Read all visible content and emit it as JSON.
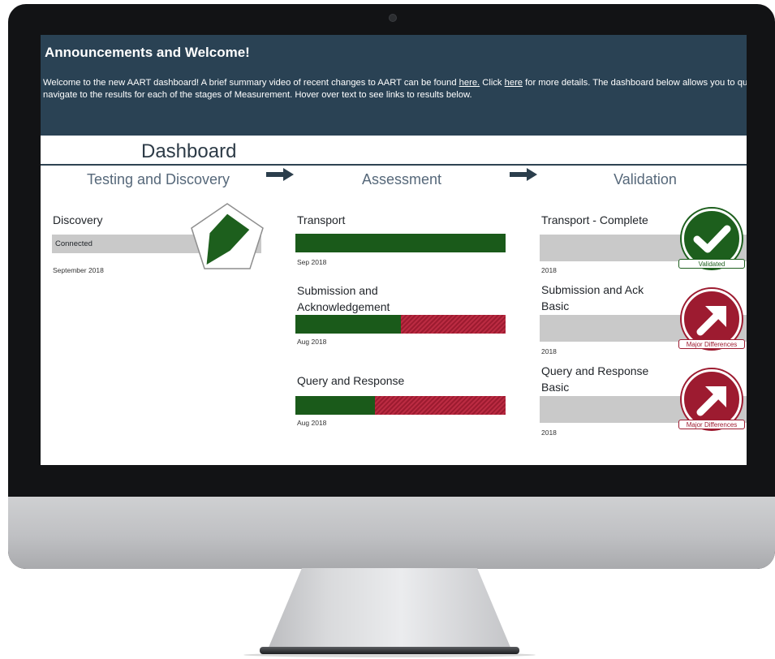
{
  "announcement": {
    "title": "Announcements and Welcome!",
    "text_1": "Welcome to the new AART dashboard! A brief summary video of recent changes to AART can be found ",
    "link_1": "here.",
    "text_2": " Click ",
    "link_2": "here",
    "text_3": " for more details. The dashboard below allows you to quickly navigate to the results for each of the stages of Measurement. Hover over text to see links to results below."
  },
  "dashboard": {
    "title": "Dashboard",
    "stages": [
      "Testing and Discovery",
      "Assessment",
      "Validation"
    ]
  },
  "discovery": {
    "title": "Discovery",
    "status": "Connected",
    "date": "September 2018"
  },
  "assessment": [
    {
      "title_line1": "Transport",
      "title_line2": "",
      "green_fraction": 1.0,
      "date": "Sep 2018"
    },
    {
      "title_line1": "Submission and",
      "title_line2": "Acknowledgement",
      "green_fraction": 0.5,
      "date": "Aug 2018"
    },
    {
      "title_line1": "Query and Response",
      "title_line2": "",
      "green_fraction": 0.38,
      "date": "Aug 2018"
    }
  ],
  "validation": [
    {
      "title_line1": "Transport - Complete",
      "title_line2": "",
      "date": "2018",
      "badge": "Validated",
      "badge_icon": "checkmark-icon",
      "status_color": "#1d5f1d"
    },
    {
      "title_line1": "Submission and Ack",
      "title_line2": "Basic",
      "date": "2018",
      "badge": "Major Differences",
      "badge_icon": "arrow-up-right-icon",
      "status_color": "#9d1b30"
    },
    {
      "title_line1": "Query and Response",
      "title_line2": "Basic",
      "date": "2018",
      "badge": "Major Differences",
      "badge_icon": "arrow-up-right-icon",
      "status_color": "#9d1b30"
    }
  ],
  "colors": {
    "header_bg": "#2a4254",
    "green": "#1a5a1a",
    "red": "#9d1b30",
    "bar_gray": "#c9c9c9"
  }
}
